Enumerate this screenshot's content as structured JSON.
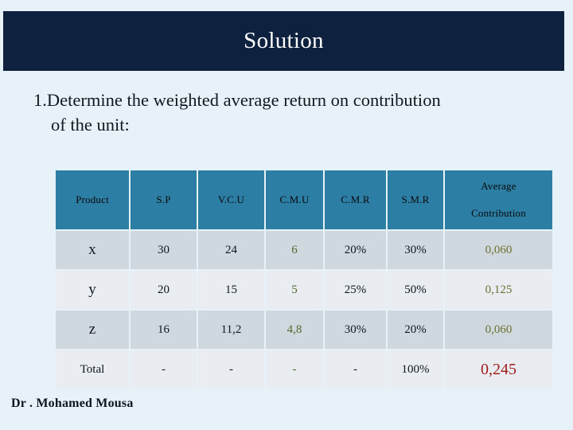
{
  "slide": {
    "title": "Solution",
    "banner_color": "#0e2240",
    "background_color": "#e6f1f8",
    "bullet": {
      "line1": "1.Determine the weighted average return on contribution",
      "line2": "of the unit:"
    },
    "footer": "Dr . Mohamed Mousa"
  },
  "table": {
    "header_color": "#2d7ea5",
    "row_color_a": "#cfd8de",
    "row_color_b": "#e9ecf1",
    "headers": [
      {
        "label": "Product",
        "line2": ""
      },
      {
        "label": "S.P",
        "line2": ""
      },
      {
        "label": "V.C.U",
        "line2": ""
      },
      {
        "label": "C.M.U",
        "line2": ""
      },
      {
        "label": "C.M.R",
        "line2": ""
      },
      {
        "label": "S.M.R",
        "line2": ""
      },
      {
        "label": "Average",
        "line2": "Contribution"
      }
    ],
    "rows": [
      {
        "product": "x",
        "sp": "30",
        "vcu": "24",
        "cmu": "6",
        "cmr": "20%",
        "smr": "30%",
        "avg": "0,060"
      },
      {
        "product": "y",
        "sp": "20",
        "vcu": "15",
        "cmu": "5",
        "cmr": "25%",
        "smr": "50%",
        "avg": "0,125"
      },
      {
        "product": "z",
        "sp": "16",
        "vcu": "11,2",
        "cmu": "4,8",
        "cmr": "30%",
        "smr": "20%",
        "avg": "0,060"
      },
      {
        "product": "Total",
        "sp": "-",
        "vcu": "-",
        "cmu": "-",
        "cmr": "-",
        "smr": "100%",
        "avg": "0,245"
      }
    ],
    "cmu_color": "#56682c",
    "avg_color": "#6d7230",
    "total_avg_color": "#a01c1c"
  }
}
